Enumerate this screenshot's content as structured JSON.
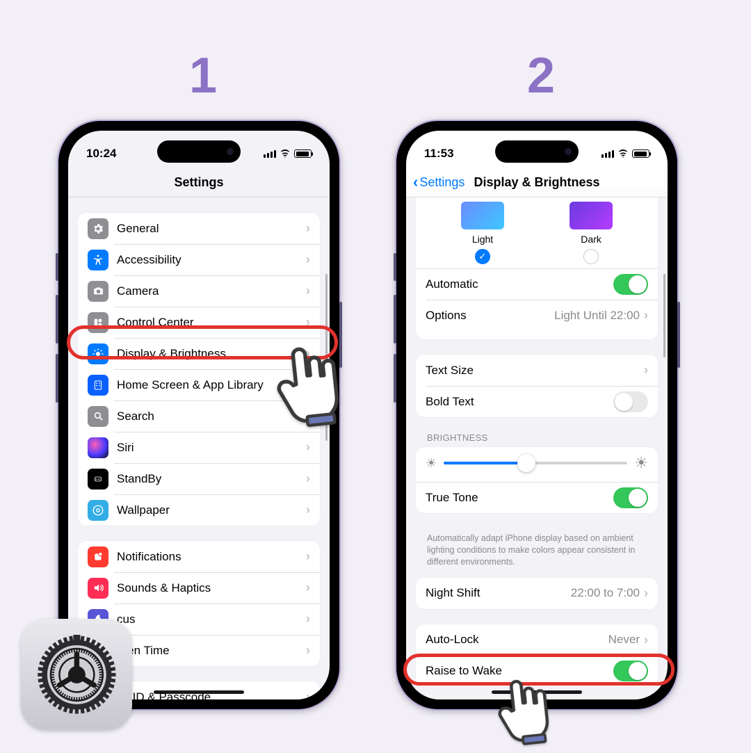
{
  "steps": {
    "one": "1",
    "two": "2"
  },
  "phone1": {
    "time": "10:24",
    "title": "Settings",
    "rows": {
      "general": "General",
      "accessibility": "Accessibility",
      "camera": "Camera",
      "controlCenter": "Control Center",
      "displayBrightness": "Display & Brightness",
      "homeScreen": "Home Screen & App Library",
      "search": "Search",
      "siri": "Siri",
      "standby": "StandBy",
      "wallpaper": "Wallpaper",
      "notifications": "Notifications",
      "sounds": "Sounds & Haptics",
      "focus": "cus",
      "screenTime": "reen Time",
      "faceID": "ce ID & Passcode"
    }
  },
  "phone2": {
    "time": "11:53",
    "back": "Settings",
    "title": "Display & Brightness",
    "appearance": {
      "light": "Light",
      "dark": "Dark"
    },
    "automatic": "Automatic",
    "options": "Options",
    "optionsValue": "Light Until 22:00",
    "textSize": "Text Size",
    "boldText": "Bold Text",
    "brightnessHeader": "BRIGHTNESS",
    "trueTone": "True Tone",
    "trueToneNote": "Automatically adapt iPhone display based on ambient lighting conditions to make colors appear consistent in different environments.",
    "nightShift": "Night Shift",
    "nightShiftValue": "22:00 to 7:00",
    "autoLock": "Auto-Lock",
    "autoLockValue": "Never",
    "raiseToWake": "Raise to Wake"
  }
}
